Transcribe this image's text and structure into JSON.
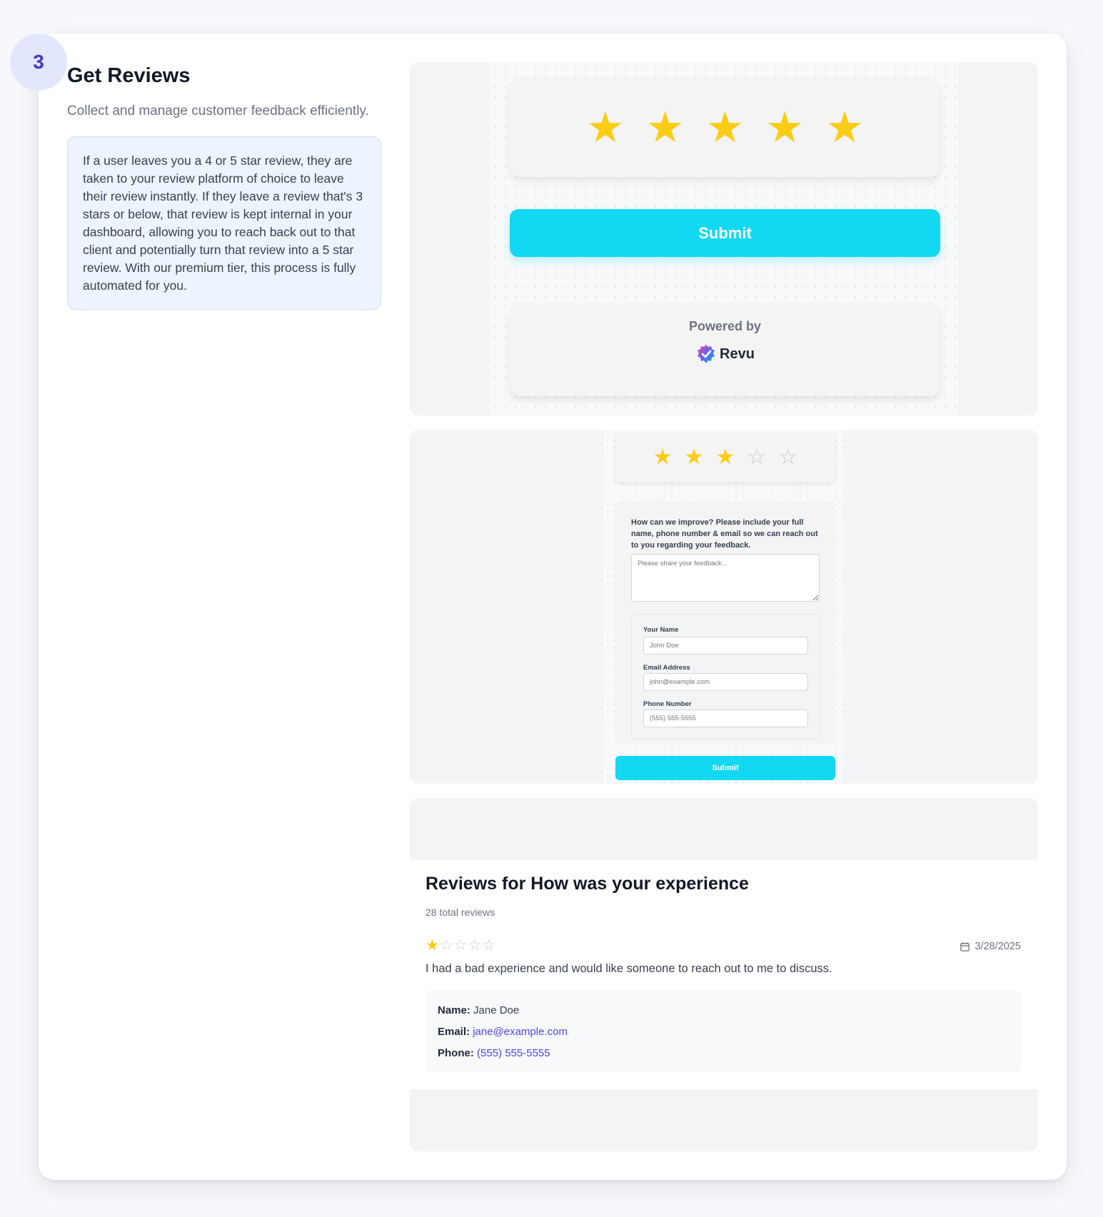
{
  "step": {
    "number": "3"
  },
  "section": {
    "title": "Get Reviews",
    "subtitle": "Collect and manage customer feedback efficiently.",
    "description": "If a user leaves you a 4 or 5 star review, they are taken to your review platform of choice to leave their review instantly. If they leave a review that's 3 stars or below, that review is kept internal in your dashboard, allowing you to reach back out to that client and potentially turn that review into a 5 star review. With our premium tier, this process is fully automated for you."
  },
  "positive_flow": {
    "rating": 5,
    "max_rating": 5,
    "submit_label": "Submit",
    "powered_by_label": "Powered by",
    "brand_name": "Revu"
  },
  "negative_flow": {
    "rating": 3,
    "max_rating": 5,
    "question": "How can we improve? Please include your full name, phone number & email so we can reach out to you regarding your feedback.",
    "feedback_placeholder": "Please share your feedback...",
    "name_label": "Your Name",
    "name_placeholder": "John Doe",
    "email_label": "Email Address",
    "email_placeholder": "john@example.com",
    "phone_label": "Phone Number",
    "phone_placeholder": "(555) 555-5555",
    "submit_label": "Submit"
  },
  "dashboard": {
    "title": "Reviews for How was your experience",
    "total": "28 total reviews",
    "review": {
      "rating": 1,
      "max_rating": 5,
      "date": "3/28/2025",
      "text": "I had a bad experience and would like someone to reach out to me to discuss.",
      "name_label": "Name:",
      "name": "Jane Doe",
      "email_label": "Email:",
      "email": "jane@example.com",
      "phone_label": "Phone:",
      "phone": "(555) 555-5555"
    }
  },
  "colors": {
    "accent": "#13d8f1",
    "star": "#facc15",
    "star_empty": "#c9ccd1",
    "badge_bg": "#e3e7fd",
    "badge_text": "#4338ca",
    "link": "#4f46e5"
  },
  "icons": {
    "star": "star-icon",
    "calendar": "calendar-icon",
    "logo": "revu-logo-icon"
  }
}
